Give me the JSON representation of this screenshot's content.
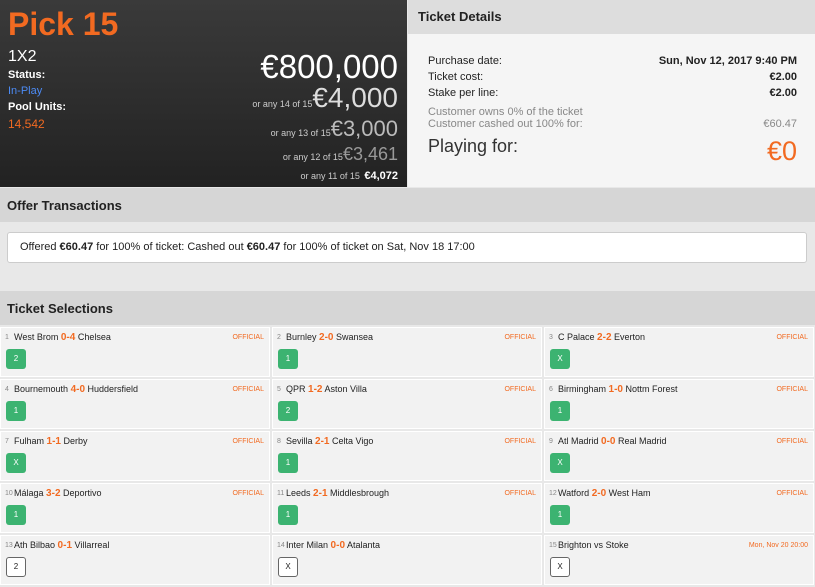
{
  "pick": {
    "title": "Pick 15",
    "type": "1X2",
    "status_label": "Status:",
    "status_value": "In-Play",
    "units_label": "Pool Units:",
    "units_value": "14,542",
    "prize_main": "€800,000",
    "tiers": [
      {
        "pre": "or any 14 of 15",
        "amount": "€4,000"
      },
      {
        "pre": "or any 13 of 15",
        "amount": "€3,000"
      },
      {
        "pre": "or any 12 of 15",
        "amount": "€3,461"
      },
      {
        "pre": "or any 11 of 15",
        "amount": "€4,072"
      }
    ]
  },
  "details": {
    "title": "Ticket Details",
    "rows": [
      {
        "label": "Purchase date:",
        "value": "Sun, Nov 12, 2017 9:40 PM"
      },
      {
        "label": "Ticket cost:",
        "value": "€2.00"
      },
      {
        "label": "Stake per line:",
        "value": "€2.00"
      }
    ],
    "owns": "Customer owns 0% of the ticket",
    "cashed_label": "Customer cashed out 100% for:",
    "cashed_value": "€60.47",
    "playing_label": "Playing for:",
    "playing_value": "€0"
  },
  "offers": {
    "title": "Offer Transactions",
    "p1": "Offered ",
    "a1": "€60.47",
    "p2": " for 100% of ticket: Cashed out ",
    "a2": "€60.47",
    "p3": " for 100% of ticket on Sat, Nov 18 17:00"
  },
  "selections": {
    "title": "Ticket Selections",
    "items": [
      {
        "num": "1",
        "home": "West Brom",
        "score": "0-4",
        "away": "Chelsea",
        "state": "OFFICIAL",
        "pick": "2",
        "settled": true
      },
      {
        "num": "2",
        "home": "Burnley",
        "score": "2-0",
        "away": "Swansea",
        "state": "OFFICIAL",
        "pick": "1",
        "settled": true
      },
      {
        "num": "3",
        "home": "C Palace",
        "score": "2-2",
        "away": "Everton",
        "state": "OFFICIAL",
        "pick": "X",
        "settled": true
      },
      {
        "num": "4",
        "home": "Bournemouth",
        "score": "4-0",
        "away": "Huddersfield",
        "state": "OFFICIAL",
        "pick": "1",
        "settled": true
      },
      {
        "num": "5",
        "home": "QPR",
        "score": "1-2",
        "away": "Aston Villa",
        "state": "OFFICIAL",
        "pick": "2",
        "settled": true
      },
      {
        "num": "6",
        "home": "Birmingham",
        "score": "1-0",
        "away": "Nottm Forest",
        "state": "OFFICIAL",
        "pick": "1",
        "settled": true
      },
      {
        "num": "7",
        "home": "Fulham",
        "score": "1-1",
        "away": "Derby",
        "state": "OFFICIAL",
        "pick": "X",
        "settled": true
      },
      {
        "num": "8",
        "home": "Sevilla",
        "score": "2-1",
        "away": "Celta Vigo",
        "state": "OFFICIAL",
        "pick": "1",
        "settled": true
      },
      {
        "num": "9",
        "home": "Atl Madrid",
        "score": "0-0",
        "away": "Real Madrid",
        "state": "OFFICIAL",
        "pick": "X",
        "settled": true
      },
      {
        "num": "10",
        "home": "Málaga",
        "score": "3-2",
        "away": "Deportivo",
        "state": "OFFICIAL",
        "pick": "1",
        "settled": true
      },
      {
        "num": "11",
        "home": "Leeds",
        "score": "2-1",
        "away": "Middlesbrough",
        "state": "OFFICIAL",
        "pick": "1",
        "settled": true
      },
      {
        "num": "12",
        "home": "Watford",
        "score": "2-0",
        "away": "West Ham",
        "state": "OFFICIAL",
        "pick": "1",
        "settled": true
      },
      {
        "num": "13",
        "home": "Ath Bilbao",
        "score": "0-1",
        "away": "Villarreal",
        "state": "",
        "pick": "2",
        "settled": false
      },
      {
        "num": "14",
        "home": "Inter Milan",
        "score": "0-0",
        "away": "Atalanta",
        "state": "",
        "pick": "X",
        "settled": false
      },
      {
        "num": "15",
        "home": "Brighton",
        "score": "",
        "away": "Stoke",
        "vs": "vs",
        "state": "Mon, Nov 20 20:00",
        "pick": "X",
        "settled": false
      }
    ]
  }
}
